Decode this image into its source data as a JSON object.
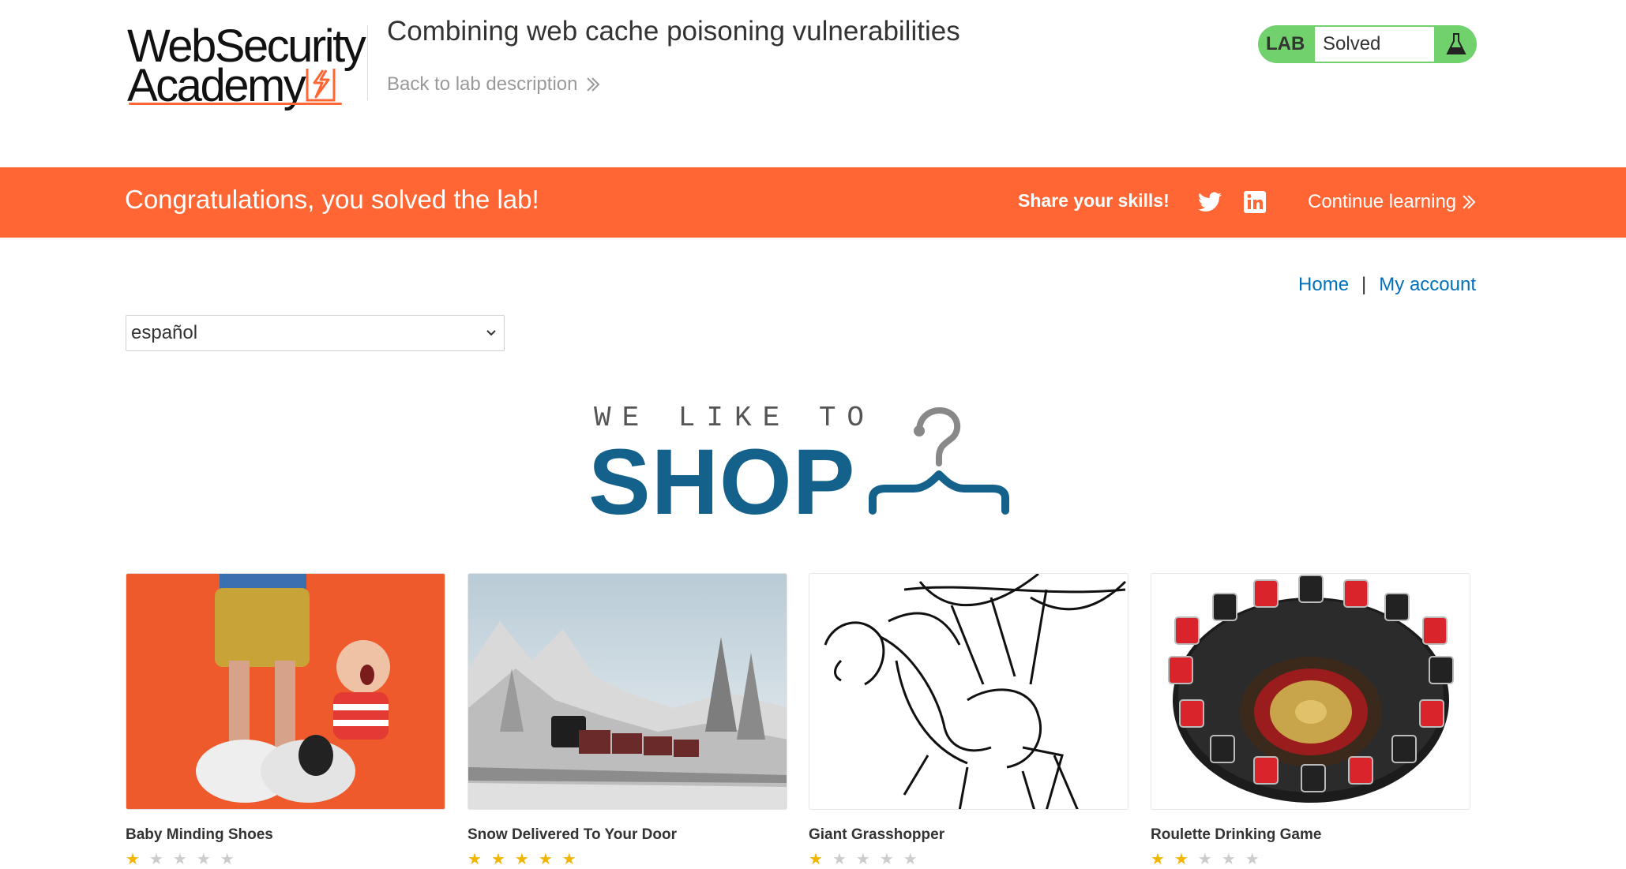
{
  "header": {
    "logo_line1": "WebSecurity",
    "logo_line2": "Academy",
    "lab_title": "Combining web cache poisoning vulnerabilities",
    "back_link": "Back to lab description",
    "lab_badge": "LAB",
    "lab_status": "Solved"
  },
  "banner": {
    "message": "Congratulations, you solved the lab!",
    "share_label": "Share your skills!",
    "continue_link": "Continue learning"
  },
  "nav": {
    "home": "Home",
    "separator": "|",
    "account": "My account"
  },
  "language": {
    "selected": "español"
  },
  "shop": {
    "tagline": "WE LIKE TO",
    "word": "SHOP"
  },
  "products": [
    {
      "name": "Baby Minding Shoes",
      "rating": 1
    },
    {
      "name": "Snow Delivered To Your Door",
      "rating": 5
    },
    {
      "name": "Giant Grasshopper",
      "rating": 1
    },
    {
      "name": "Roulette Drinking Game",
      "rating": 2
    }
  ],
  "colors": {
    "brand_orange": "#ff6633",
    "lab_green": "#70d16d",
    "link_blue": "#0071bc",
    "shop_blue": "#14628c"
  }
}
